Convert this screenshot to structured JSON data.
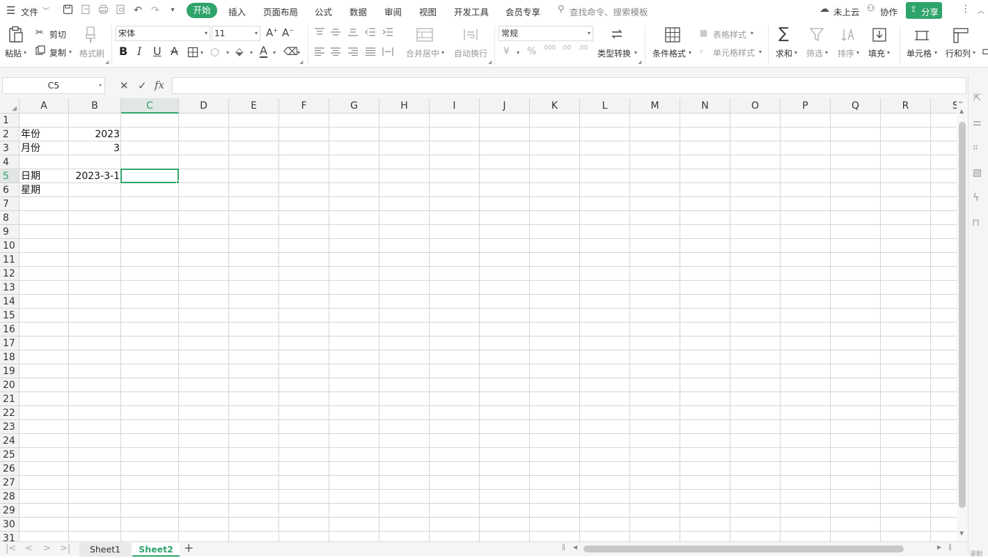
{
  "menubar": {
    "file_label": "文件",
    "tabs": [
      "开始",
      "插入",
      "页面布局",
      "公式",
      "数据",
      "审阅",
      "视图",
      "开发工具",
      "会员专享"
    ],
    "search_placeholder": "查找命令、搜索模板",
    "cloud_label": "未上云",
    "collab_label": "协作",
    "share_label": "分享"
  },
  "ribbon": {
    "paste": "粘贴",
    "cut": "剪切",
    "copy": "复制",
    "format_painter": "格式刷",
    "font_name": "宋体",
    "font_size": "11",
    "merge_center": "合并居中",
    "wrap_text": "自动换行",
    "number_format": "常规",
    "type_convert": "类型转换",
    "conditional_format": "条件格式",
    "table_style": "表格样式",
    "cell_style": "单元格样式",
    "sum": "求和",
    "filter": "筛选",
    "sort": "排序",
    "fill": "填充",
    "cell": "单元格",
    "row_col": "行和列",
    "bold": "B",
    "italic": "I",
    "underline": "U",
    "strike": "A",
    "font_color": "A",
    "percent": "%",
    "currency": "¥",
    "thousands": "000",
    "inc_decimal": ".00",
    "dec_decimal": ".00"
  },
  "formula": {
    "name_box": "C5",
    "fx": "fx",
    "content": ""
  },
  "grid": {
    "columns": [
      "A",
      "B",
      "C",
      "D",
      "E",
      "F",
      "G",
      "H",
      "I",
      "J",
      "K",
      "L",
      "M",
      "N",
      "O",
      "P",
      "Q",
      "R",
      "S"
    ],
    "rows": [
      "1",
      "2",
      "3",
      "4",
      "5",
      "6",
      "7",
      "8",
      "9",
      "10",
      "11",
      "12",
      "13",
      "14",
      "15",
      "16",
      "17",
      "18",
      "19",
      "20",
      "21",
      "22",
      "23",
      "24",
      "25",
      "26",
      "27",
      "28",
      "29",
      "30",
      "31"
    ],
    "selected_col": "C",
    "selected_row": "5",
    "cells": {
      "A2": "年份",
      "B2": "2023",
      "A3": "月份",
      "B3": "3",
      "A5": "日期",
      "B5": "2023-3-1",
      "A6": "星期"
    }
  },
  "sheets": {
    "tabs": [
      "Sheet1",
      "Sheet2"
    ],
    "active": "Sheet2",
    "add": "+"
  },
  "sidepanel": {
    "record_label": "录制"
  },
  "colors": {
    "accent": "#2ea36a",
    "grid_line": "#d4d4d4"
  }
}
